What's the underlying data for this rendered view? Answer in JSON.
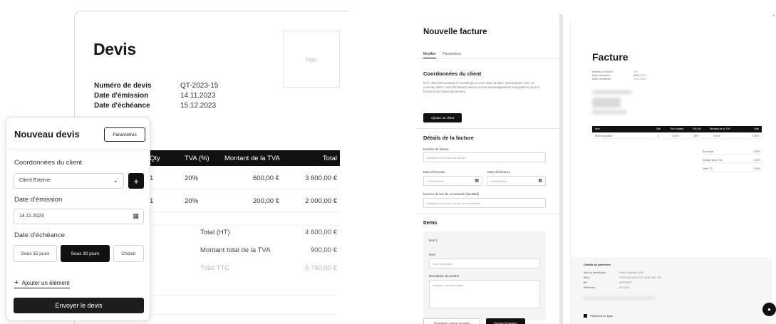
{
  "devis": {
    "title": "Devis",
    "logo": "logo",
    "meta": [
      {
        "label": "Numéro de devis",
        "value": "QT-2023-15"
      },
      {
        "label": "Date d'émission",
        "value": "14.11.2023"
      },
      {
        "label": "Date d'échéance",
        "value": "15.12.2023"
      }
    ],
    "columns": {
      "qty": "Qty",
      "tva": "TVA (%)",
      "montant_tva": "Montant de la TVA",
      "total": "Total"
    },
    "rows": [
      {
        "qty": "1",
        "tva": "20%",
        "montant_tva": "600,00 €",
        "total": "3 600,00 €"
      },
      {
        "qty": "1",
        "tva": "20%",
        "montant_tva": "200,00 €",
        "total": "2 000,00 €"
      }
    ],
    "totals": [
      {
        "label": "Total (HT)",
        "value": "4 600,00 €"
      },
      {
        "label": "Montant total de la TVA",
        "value": "900,00 €"
      },
      {
        "label": "Total TTC",
        "value": "5 760,00 €"
      }
    ]
  },
  "nouveau_devis": {
    "title": "Nouveau devis",
    "settings_label": "Paramètres",
    "client_section_label": "Coordonnées du client",
    "client_selected": "Client Externe",
    "client_plus": "+",
    "emission_label": "Date d'émission",
    "emission_value": "14.11.2023",
    "echeance_label": "Date d'échéance",
    "echeance_options": [
      "Sous 15 jours",
      "Sous 30 jours",
      "Choisir"
    ],
    "echeance_selected_index": 1,
    "add_item_label": "Ajouter un élément",
    "send_label": "Envoyer le devis",
    "icons": {
      "dropdown": "chevron-down-icon",
      "calendar": "calendar-icon",
      "add": "plus-icon"
    }
  },
  "nouvelle_facture": {
    "title": "Nouvelle facture",
    "tabs": [
      "Modifier",
      "Paramètres"
    ],
    "client_heading": "Coordonnées du client",
    "client_text": "Si le client est nouveau et n'existe pas encore dans la base, vous pouvez créer un nouveau client. Les informations saisies seront automatiquement enregistrées pour la facture et les futurs documents.",
    "client_button": "Ajouter un client",
    "details_heading": "Détails de la facture",
    "invoice_number_label": "Numéro de facture",
    "invoice_number_placeholder": "Indiquez un numéro de facture",
    "issue_date_label": "Date d'émission",
    "issue_date_value": "JJ/MM/AAAA",
    "due_date_label": "Date d'échéance",
    "due_date_value": "JJ/MM/AAAA",
    "po_label": "Numéro de bon de commande (facultatif)",
    "po_placeholder": "Indiquez un numéro de bon de commande",
    "items_heading": "Items",
    "item_name": "Item 1",
    "item_name_label": "Nom",
    "item_name_value": "Nom du produit",
    "item_desc_label": "Description du produit",
    "item_desc_placeholder": "Indiquez une description",
    "bottom_buttons": [
      "Enregistrer comme brouillon",
      "Envoyer la facture"
    ]
  },
  "invoice_preview": {
    "title": "Facture",
    "meta": [
      {
        "label": "Numéro de facture",
        "value": "INV-0001"
      },
      {
        "label": "Date d'émission",
        "value": "14/11/2023"
      },
      {
        "label": "Date d'échéance",
        "value": "15/12/2023"
      }
    ],
    "columns": [
      "Item",
      "Qté",
      "Prix unitaire",
      "TVA (%)",
      "Montant de la TVA",
      "Total"
    ],
    "row": [
      "Nom du produit",
      "1",
      "0,00 €",
      "20%",
      "0,00 €",
      "0,00 €"
    ],
    "totals": [
      {
        "label": "Sous-total",
        "value": "0,00 €"
      },
      {
        "label": "Montant de la TVA",
        "value": "0,00 €"
      },
      {
        "label": "Total TTC",
        "value": "0,00 €"
      }
    ],
    "footer_heading": "Détails du paiement",
    "footer_rows": [
      {
        "label": "Nom du bénéficiaire",
        "value": "Votre Entreprise SARL"
      },
      {
        "label": "IBAN",
        "value": "FR76 3000 6000 0112 3456 7890 189"
      },
      {
        "label": "BIC",
        "value": "AGRIFRPP"
      },
      {
        "label": "Référence",
        "value": "INV-0001"
      }
    ],
    "footer_check": "Paiement en ligne",
    "close_icon": "close-icon",
    "chat_icon": "chat-bubble-icon"
  }
}
